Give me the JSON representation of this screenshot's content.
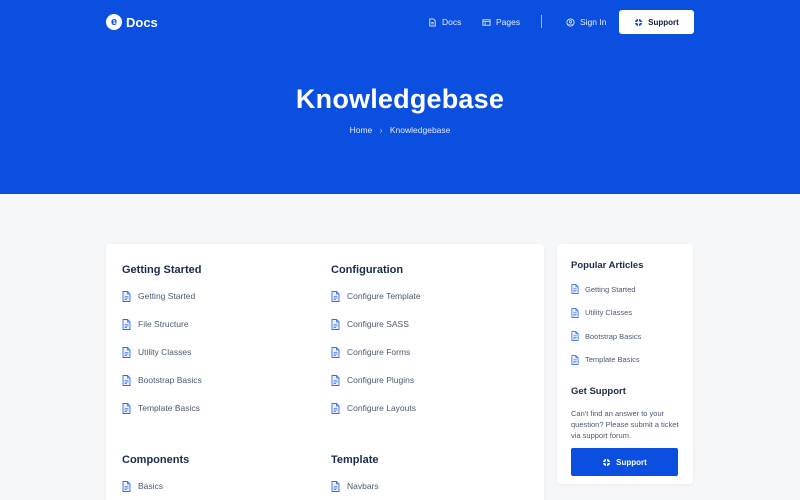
{
  "brand": {
    "logo_letter": "e",
    "name": "Docs"
  },
  "nav": {
    "docs_label": "Docs",
    "pages_label": "Pages",
    "signin_label": "Sign In",
    "support_label": "Support"
  },
  "hero": {
    "title": "Knowledgebase",
    "breadcrumb": {
      "home": "Home",
      "separator": "›",
      "current": "Knowledgebase"
    }
  },
  "sections": {
    "getting_started": {
      "title": "Getting Started",
      "items": [
        "Getting Started",
        "File Structure",
        "Utility Classes",
        "Bootstrap Basics",
        "Template Basics"
      ]
    },
    "configuration": {
      "title": "Configuration",
      "items": [
        "Configure Template",
        "Configure SASS",
        "Configure Forms",
        "Configure Plugins",
        "Configure Layouts"
      ]
    },
    "components": {
      "title": "Components",
      "items": [
        "Basics"
      ]
    },
    "template": {
      "title": "Template",
      "items": [
        "Navbars"
      ]
    }
  },
  "sidebar": {
    "popular_title": "Popular Articles",
    "popular_items": [
      "Getting Started",
      "Utility Classes",
      "Bootstrap Basics",
      "Template Basics"
    ],
    "support_title": "Get Support",
    "support_text": "Can't find an answer to your question? Please submit a ticket via support forum.",
    "support_button": "Support"
  },
  "colors": {
    "primary": "#0a4fe0",
    "background": "#f6f7f9",
    "heading": "#1b2a4a",
    "text": "#4c5870"
  },
  "icons": {
    "article": "document-icon",
    "docs": "file-icon",
    "pages": "window-icon",
    "signin": "user-circle-icon",
    "support": "lifebuoy-icon"
  }
}
